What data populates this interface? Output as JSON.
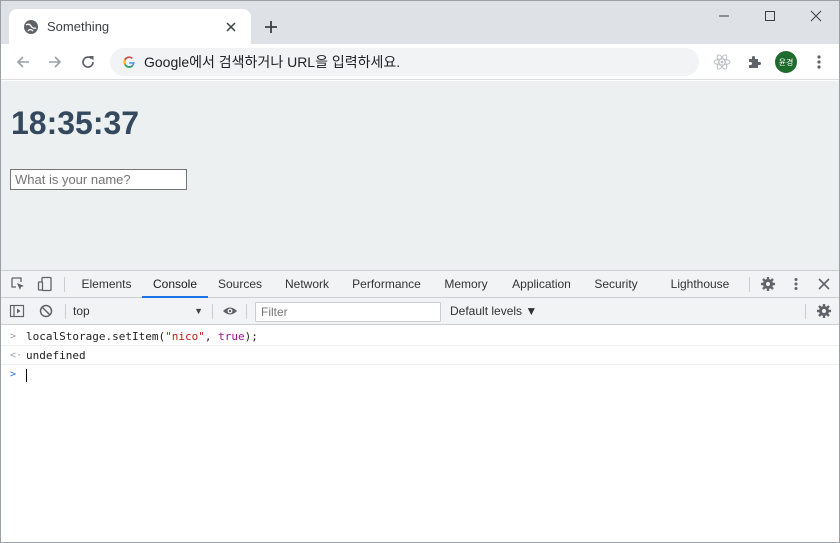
{
  "browser": {
    "tab_title": "Something",
    "omnibox_text": "Google에서 검색하거나 URL을 입력하세요.",
    "avatar_text": "윤경"
  },
  "page": {
    "clock": "18:35:37",
    "name_placeholder": "What is your name?"
  },
  "devtools": {
    "tabs": [
      "Elements",
      "Console",
      "Sources",
      "Network",
      "Performance",
      "Memory",
      "Application",
      "Security",
      "Lighthouse"
    ],
    "active_tab": "Console",
    "context": "top",
    "filter_placeholder": "Filter",
    "levels_label": "Default levels ▼",
    "console": {
      "input_prefix": "localStorage.setItem(",
      "input_arg1": "\"nico\"",
      "input_sep": ", ",
      "input_arg2": "true",
      "input_suffix": ");",
      "output": "undefined"
    }
  },
  "colors": {
    "page_bg": "#ecf0f1",
    "clock_color": "#34495e",
    "accent": "#1a73e8"
  }
}
